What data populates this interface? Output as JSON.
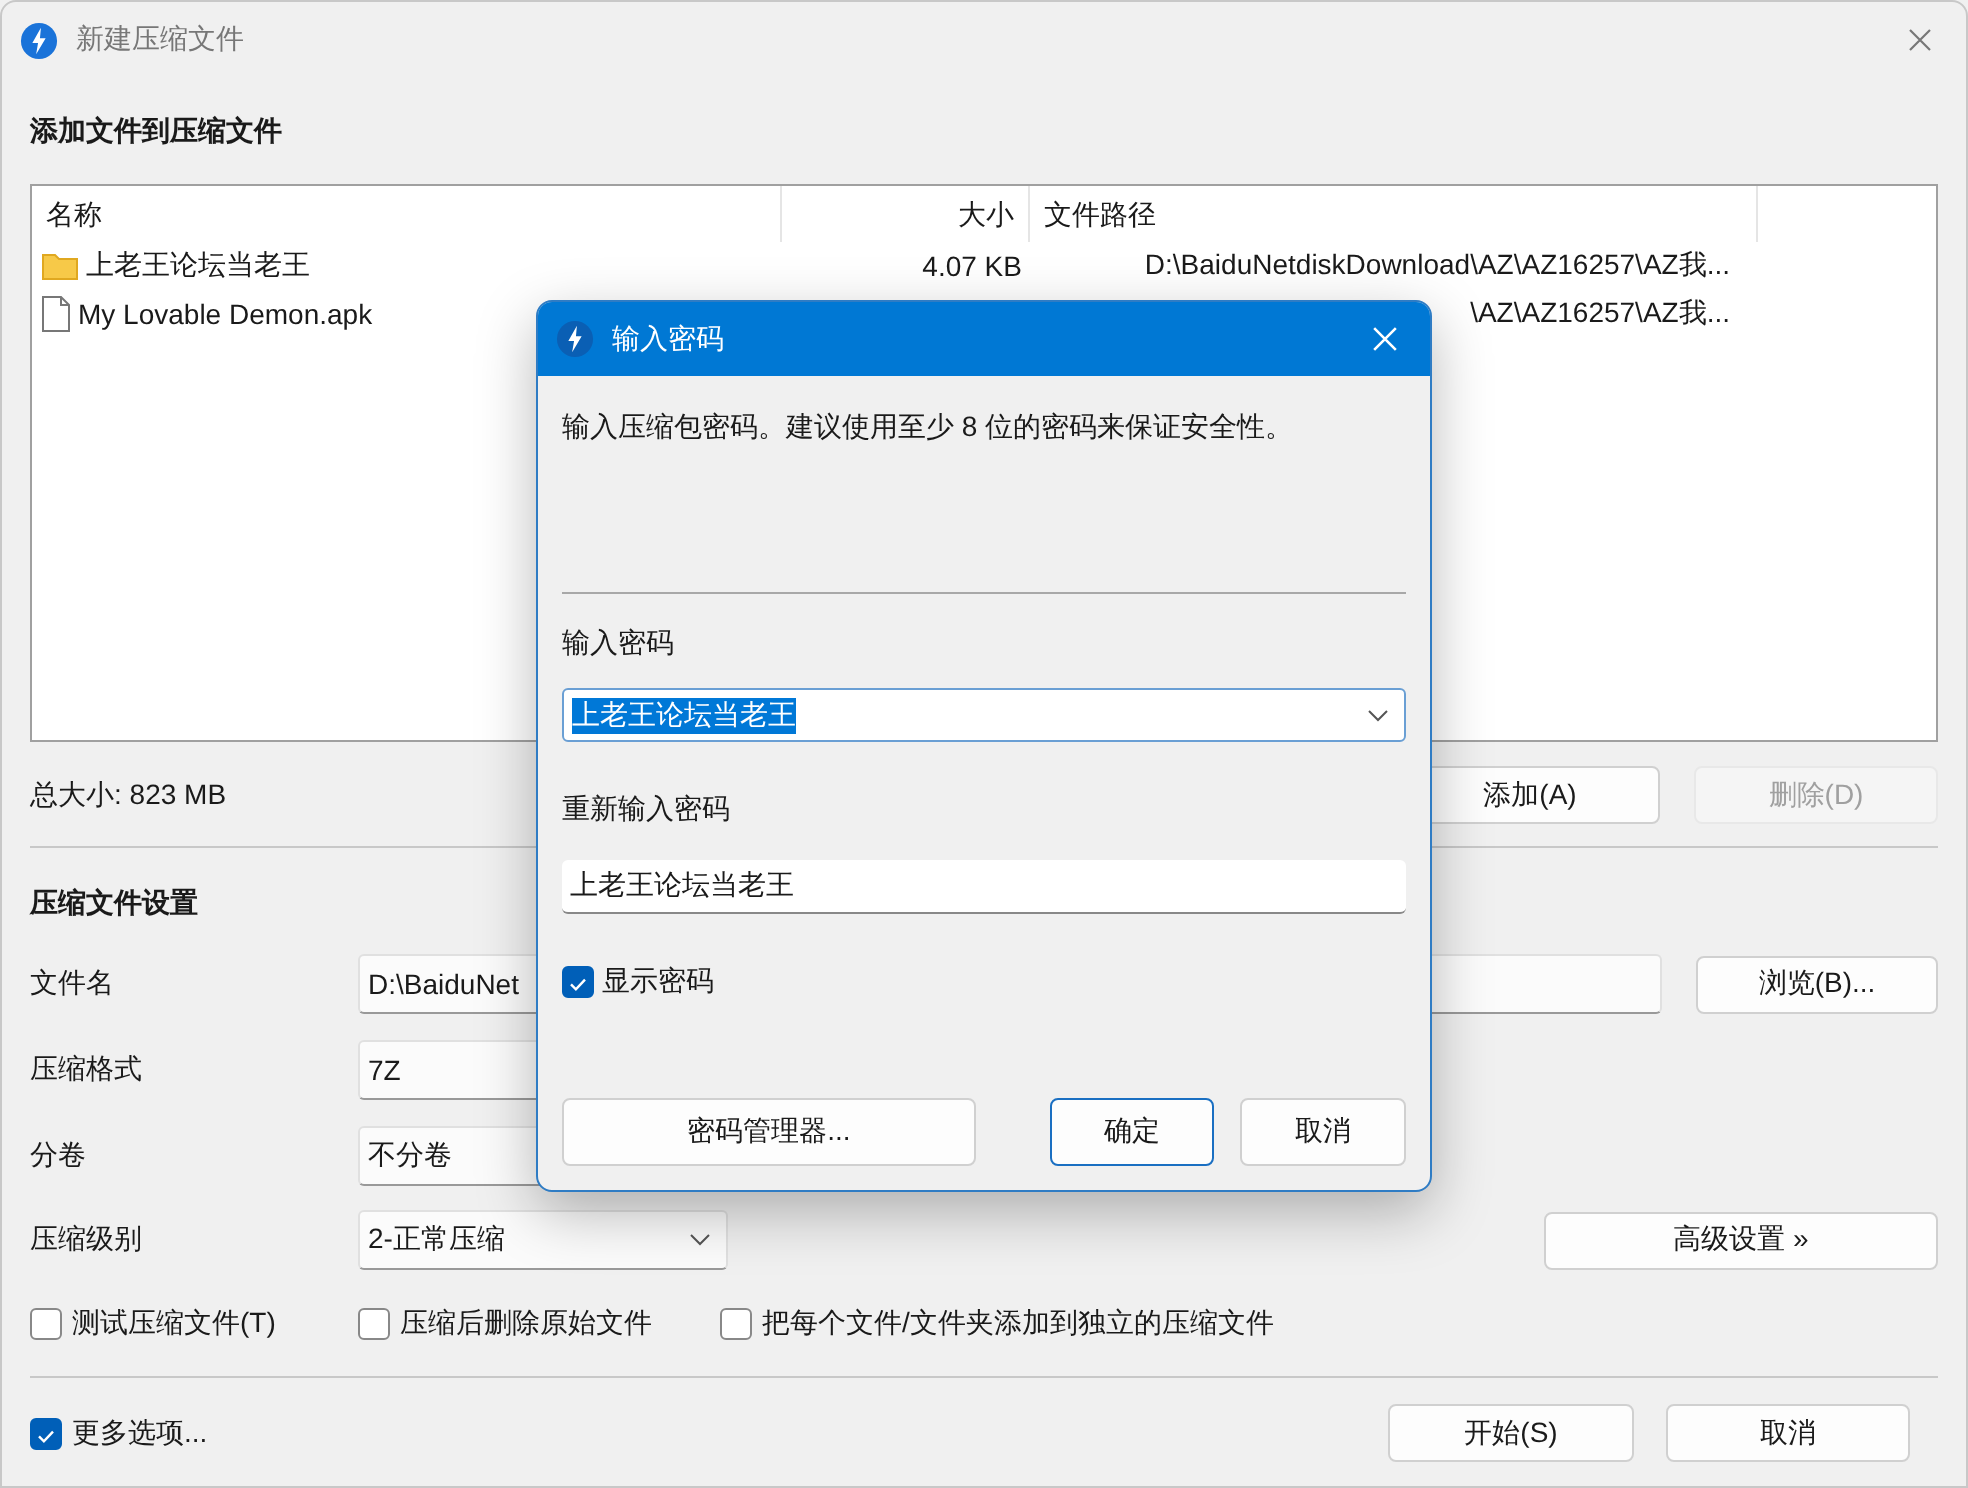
{
  "window": {
    "title": "新建压缩文件"
  },
  "files_section": {
    "heading": "添加文件到压缩文件",
    "columns": [
      "名称",
      "大小",
      "文件路径"
    ],
    "rows": [
      {
        "kind": "folder",
        "name": "上老王论坛当老王",
        "size": "4.07 KB",
        "path": "D:\\BaiduNetdiskDownload\\AZ\\AZ16257\\AZ我..."
      },
      {
        "kind": "file",
        "name": "My Lovable Demon.apk",
        "path": "\\AZ\\AZ16257\\AZ我..."
      }
    ],
    "total_size": "总大小: 823 MB",
    "buttons": [
      {
        "label": "添加(A)",
        "disabled": false
      },
      {
        "label": "删除(D)",
        "disabled": true
      }
    ]
  },
  "settings": {
    "heading": "压缩文件设置",
    "fields": [
      {
        "label": "文件名",
        "kind": "text",
        "value": "D:\\BaiduNet"
      },
      {
        "label": "压缩格式",
        "kind": "select",
        "value": "7Z"
      },
      {
        "label": "分卷",
        "kind": "select",
        "value": "不分卷"
      },
      {
        "label": "压缩级别",
        "kind": "dropdown",
        "value": "2-正常压缩"
      }
    ],
    "browse_button": "浏览(B)...",
    "advanced_button": "高级设置 »",
    "options": [
      {
        "label": "测试压缩文件(T)",
        "checked": false
      },
      {
        "label": "压缩后删除原始文件",
        "checked": false
      },
      {
        "label": "把每个文件/文件夹添加到独立的压缩文件",
        "checked": false
      }
    ]
  },
  "more_options": {
    "label": "更多选项...",
    "checked": true
  },
  "footer_buttons": [
    "开始(S)",
    "取消"
  ],
  "dialog": {
    "title": "输入密码",
    "description": "输入压缩包密码。建议使用至少 8 位的密码来保证安全性。",
    "password_label": "输入密码",
    "password": {
      "value": "上老王论坛当老王",
      "text_selected": true
    },
    "confirm_label": "重新输入密码",
    "confirm_password": "上老王论坛当老王",
    "show_password": {
      "label": "显示密码",
      "checked": true
    },
    "buttons": [
      {
        "label": "密码管理器...",
        "default": false
      },
      {
        "label": "确定",
        "default": true
      },
      {
        "label": "取消",
        "default": false
      }
    ]
  }
}
